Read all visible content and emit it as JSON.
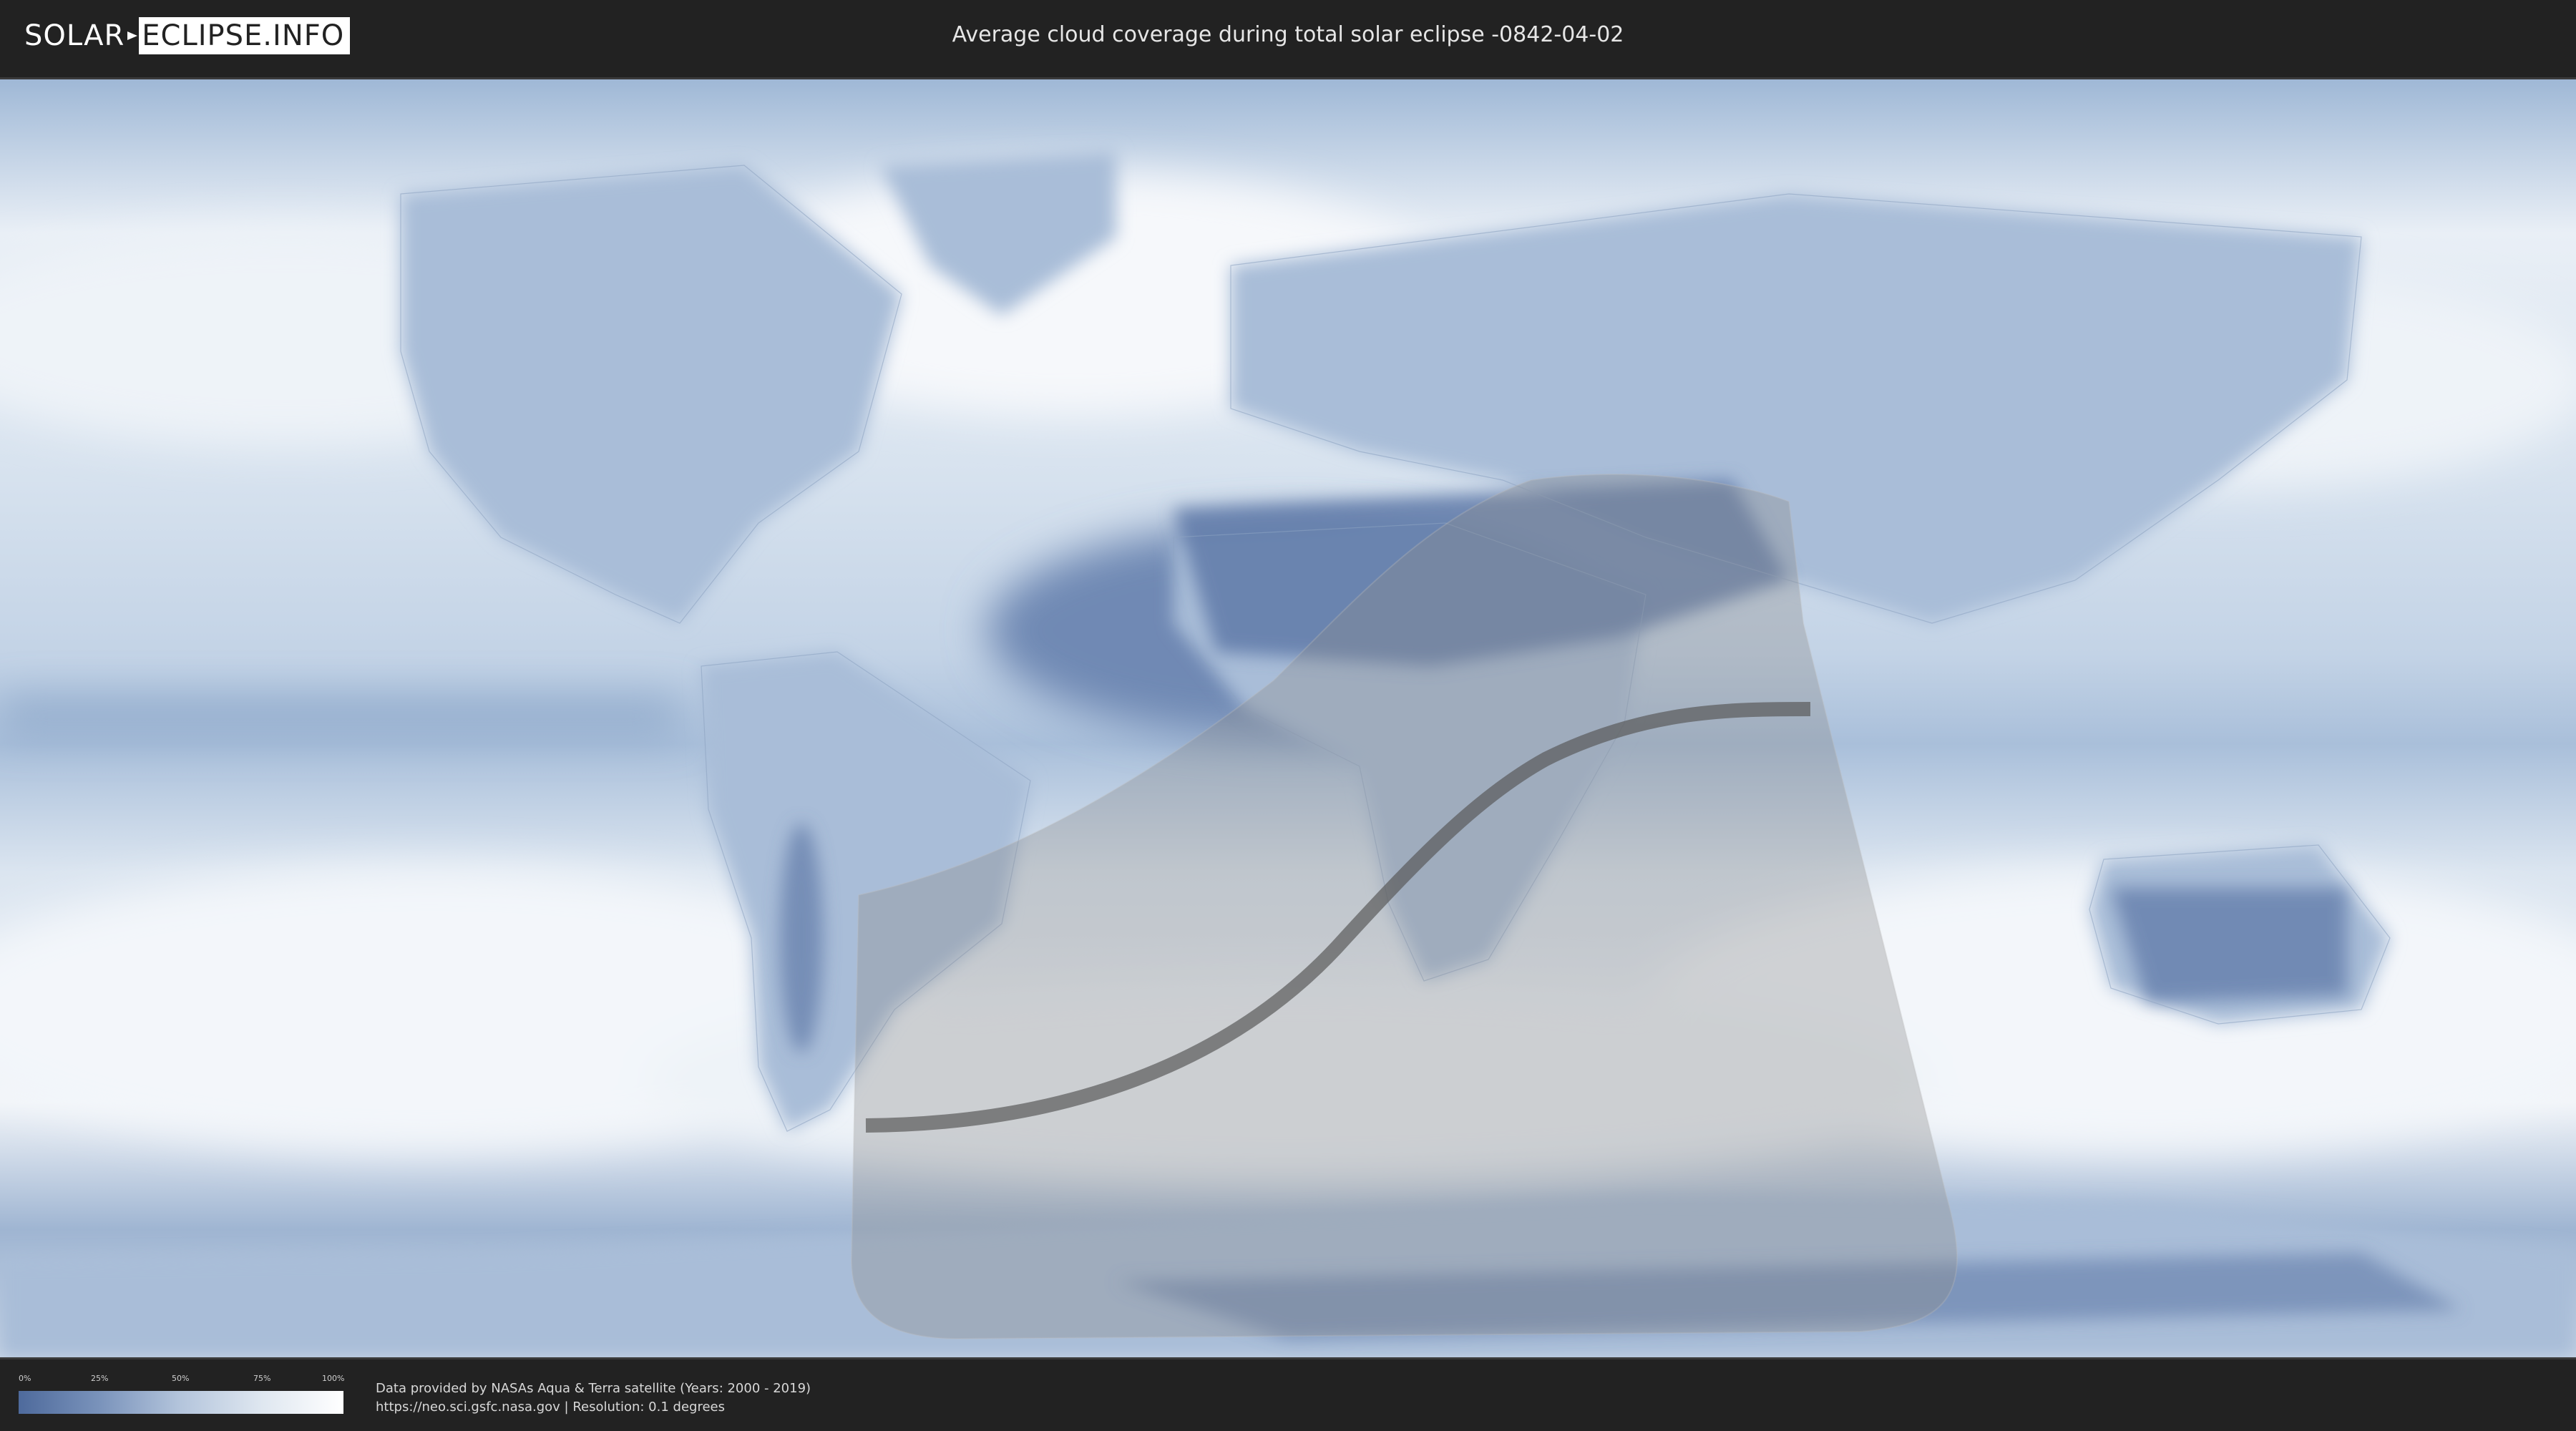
{
  "header": {
    "logo_left": "SOLAR",
    "logo_right": "ECLIPSE.INFO",
    "title": "Average cloud coverage during total solar eclipse -0842-04-02"
  },
  "map": {
    "kind": "equirectangular world cloud-coverage map",
    "projection": "equirectangular",
    "colors": {
      "clear_sky": "#4e6a9c",
      "overcast": "#ffffff",
      "eclipse_visibility_overlay": "#8c8c8c",
      "totality_path": "#5a5a5a"
    },
    "overlays": [
      "partial-eclipse-visibility-area",
      "path-of-totality"
    ]
  },
  "legend": {
    "ticks": [
      "0%",
      "25%",
      "50%",
      "75%",
      "100%"
    ],
    "low_color": "#4e6a9c",
    "high_color": "#ffffff"
  },
  "credits": {
    "line1": "Data provided by NASAs Aqua & Terra satellite (Years: 2000 - 2019)",
    "line2": "https://neo.sci.gsfc.nasa.gov | Resolution: 0.1 degrees"
  }
}
